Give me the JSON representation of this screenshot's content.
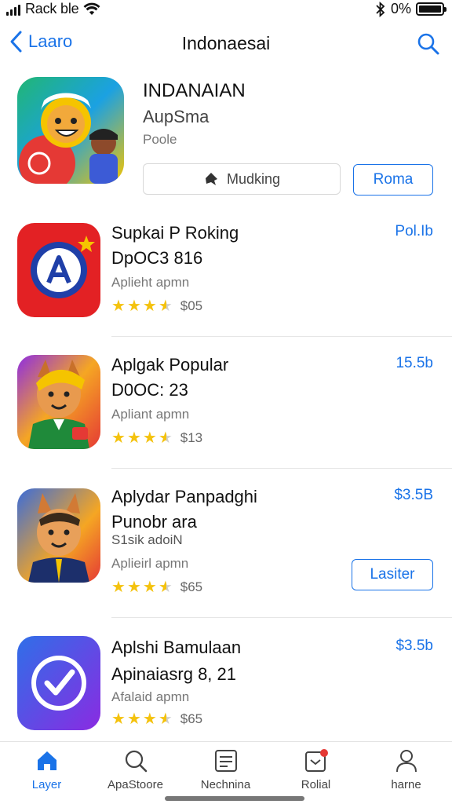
{
  "status_bar": {
    "carrier": "Rack ble",
    "battery": "0%",
    "bluetooth_icon": "bluetooth-icon",
    "wifi_icon": "wifi-icon"
  },
  "nav": {
    "back_label": "Laaro",
    "title": "Indonaesai",
    "search_icon": "search-icon"
  },
  "featured": {
    "name": "INDANAIAN",
    "subtitle": "AupSma",
    "category": "Poole",
    "action_label": "Mudking",
    "get_label": "Roma"
  },
  "apps": [
    {
      "title": "Supkai P Roking",
      "line2": "DpOC3 816",
      "developer": "Aplieht apmn",
      "rating": 3.5,
      "rating_text": "$05",
      "price": "Pol.Ib"
    },
    {
      "title": "Aplgak Popular",
      "line2": "D0OC: 23",
      "developer": "Apliant apmn",
      "rating": 3.5,
      "rating_text": "$13",
      "price": "15.5b"
    },
    {
      "title": "Aplydar Panpadghi",
      "line2": "Punobr ara",
      "line3": "S1sik adoiN",
      "developer": "Aplieirl apmn",
      "rating": 3.5,
      "rating_text": "$65",
      "price": "$3.5B",
      "button": "Lasiter"
    },
    {
      "title": "Aplshi Bamulaan",
      "line2": "Apinaiasrg 8, 21",
      "developer": "Afalaid apmn",
      "rating": 3.5,
      "rating_text": "$65",
      "price": "$3.5b"
    }
  ],
  "tabs": [
    {
      "label": "Layer",
      "icon": "home-icon",
      "active": true
    },
    {
      "label": "ApaStoore",
      "icon": "search-icon",
      "active": false
    },
    {
      "label": "Nechnina",
      "icon": "list-icon",
      "active": false
    },
    {
      "label": "Rolial",
      "icon": "notification-icon",
      "active": false
    },
    {
      "label": "harne",
      "icon": "person-icon",
      "active": false
    }
  ],
  "colors": {
    "accent": "#1a73e8",
    "star": "#f4c20d"
  }
}
